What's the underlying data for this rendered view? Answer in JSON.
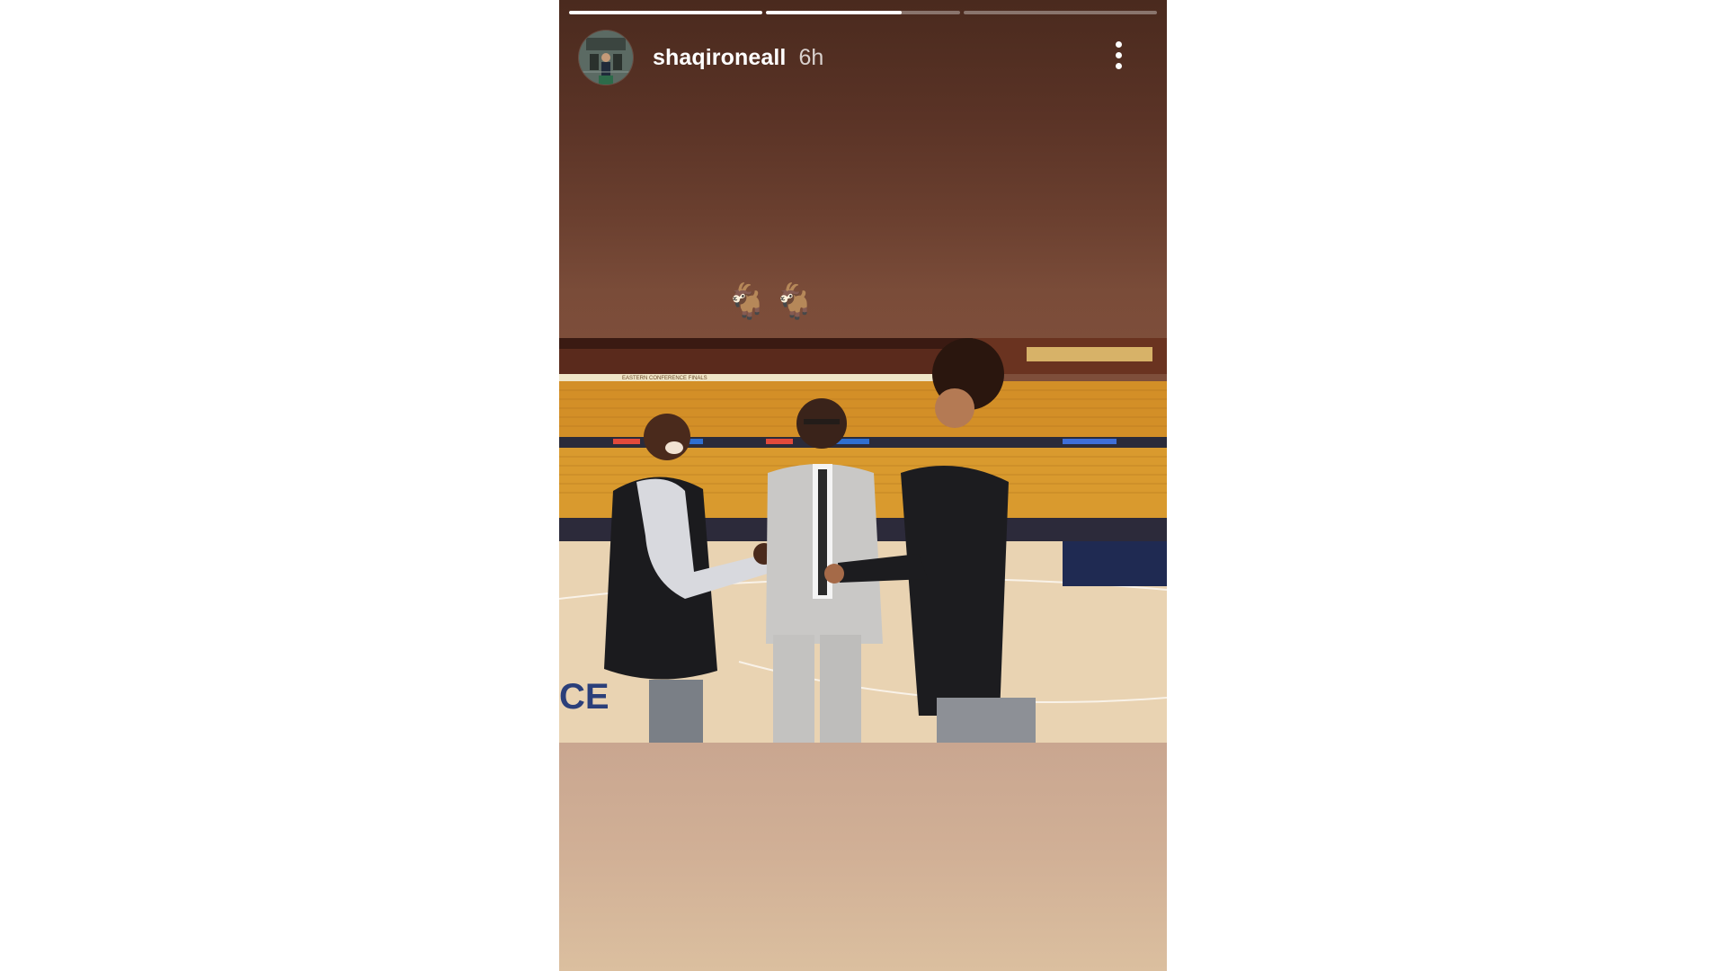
{
  "story": {
    "username": "shaqironeall",
    "time_ago": "6h",
    "caption_emoji": "🐐🐐",
    "progress": [
      1.0,
      0.7,
      0.0
    ],
    "avatar": "avatar-icon",
    "more_icon": "more-vertical-icon"
  },
  "photo": {
    "banner_text": "EASTERN CONFERENCE FINALS",
    "court_text": "CE"
  },
  "colors": {
    "story_top": "#4a2a1e",
    "story_mid": "#7e4e3a",
    "story_bottom": "#dbbf9f",
    "seats": "#d99a2e",
    "floor": "#e9d3b2"
  }
}
